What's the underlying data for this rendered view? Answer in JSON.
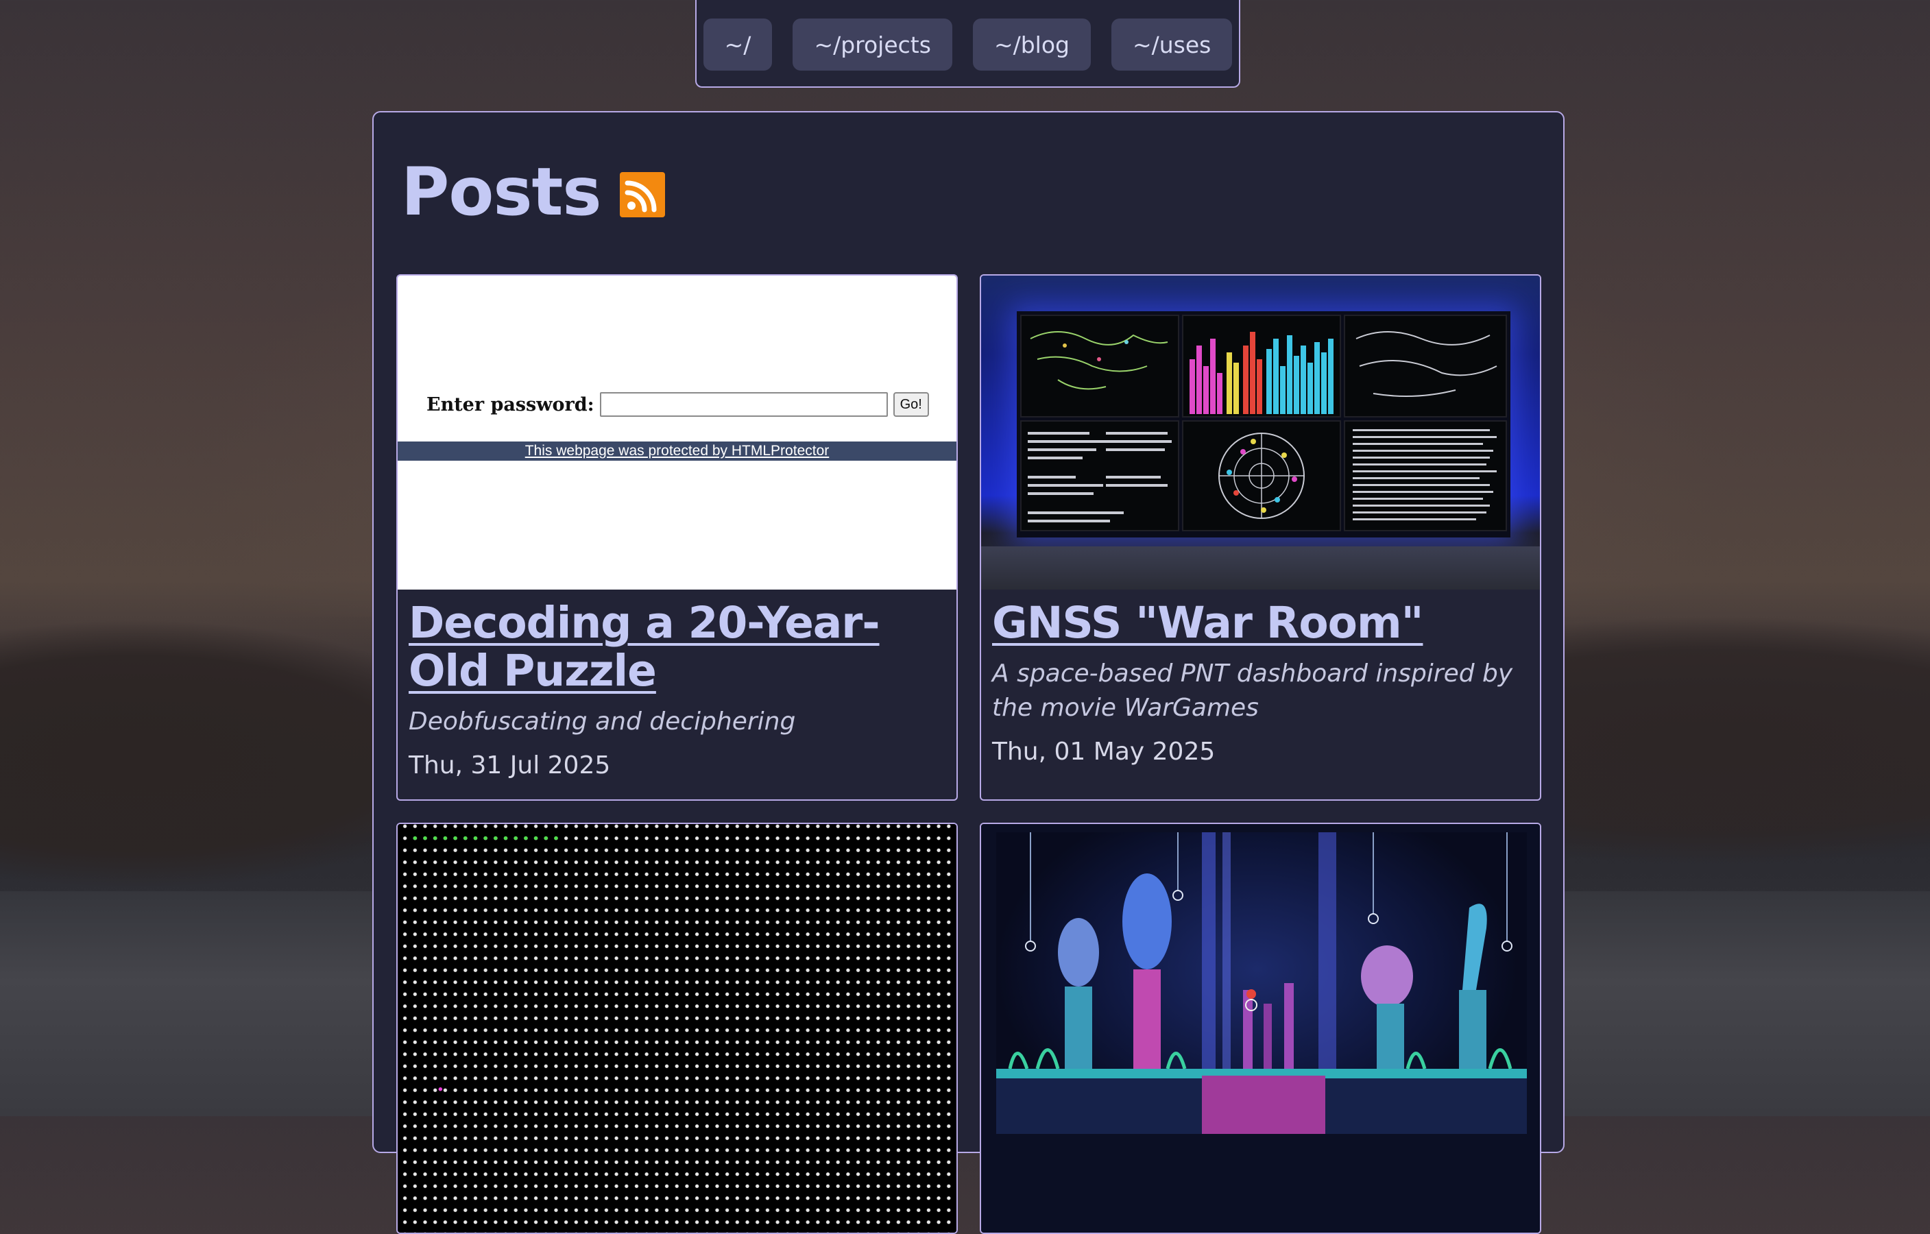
{
  "nav": {
    "items": [
      {
        "label": "~/"
      },
      {
        "label": "~/projects"
      },
      {
        "label": "~/blog"
      },
      {
        "label": "~/uses"
      }
    ]
  },
  "page": {
    "title": "Posts",
    "feed_icon": "rss-icon"
  },
  "posts": [
    {
      "title": "Decoding a 20-Year-Old Puzzle",
      "subtitle": "Deobfuscating and deciphering",
      "date": "Thu, 31 Jul 2025",
      "thumbnail": {
        "password_label": "Enter password:",
        "go_label": "Go!",
        "footer_text": "This webpage was protected by HTMLProtector"
      }
    },
    {
      "title": "GNSS \"War Room\"",
      "subtitle": "A space-based PNT dashboard inspired by the movie WarGames",
      "date": "Thu, 01 May 2025"
    },
    {
      "title": "",
      "subtitle": "",
      "date": ""
    },
    {
      "title": "",
      "subtitle": "",
      "date": ""
    }
  ],
  "colors": {
    "panel_bg": "#222336",
    "border": "#b7a9e6",
    "title_text": "#c4c9f4",
    "nav_button_bg": "#3f415d",
    "rss_orange": "#f3890f"
  }
}
